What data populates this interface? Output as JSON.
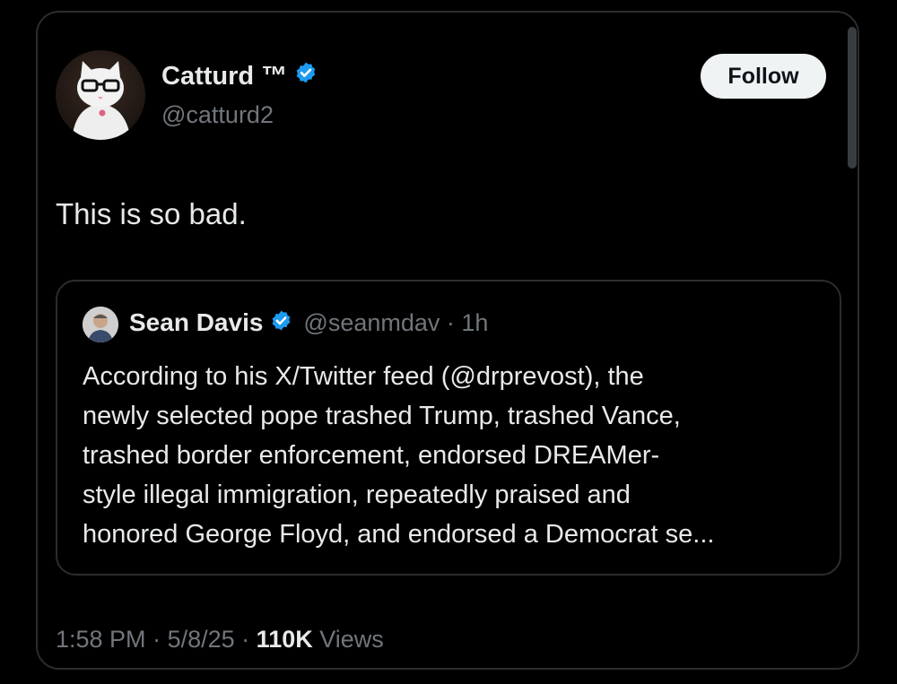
{
  "author": {
    "display_name": "Catturd ™",
    "handle": "@catturd2",
    "verified": true,
    "avatar_icon": "cat-avatar-icon"
  },
  "follow_button": {
    "label": "Follow"
  },
  "tweet": {
    "text": "This is so bad."
  },
  "quoted_tweet": {
    "display_name": "Sean Davis",
    "handle_time": "@seanmdav · 1h",
    "verified": true,
    "lines": [
      "According to his X/Twitter feed (@drprevost), the",
      "newly selected pope trashed Trump, trashed Vance,",
      "trashed border enforcement, endorsed DREAMer-",
      "style illegal immigration, repeatedly praised and",
      "honored George Floyd, and endorsed a Democrat se..."
    ]
  },
  "footer": {
    "time": "1:58 PM",
    "date": "5/8/25",
    "views_count": "110K",
    "views_label": "Views"
  },
  "colors": {
    "background": "#000000",
    "text_primary": "#e7e9ea",
    "text_secondary": "#71767b",
    "verified_blue": "#1d9bf0",
    "border": "#2a2d30"
  }
}
